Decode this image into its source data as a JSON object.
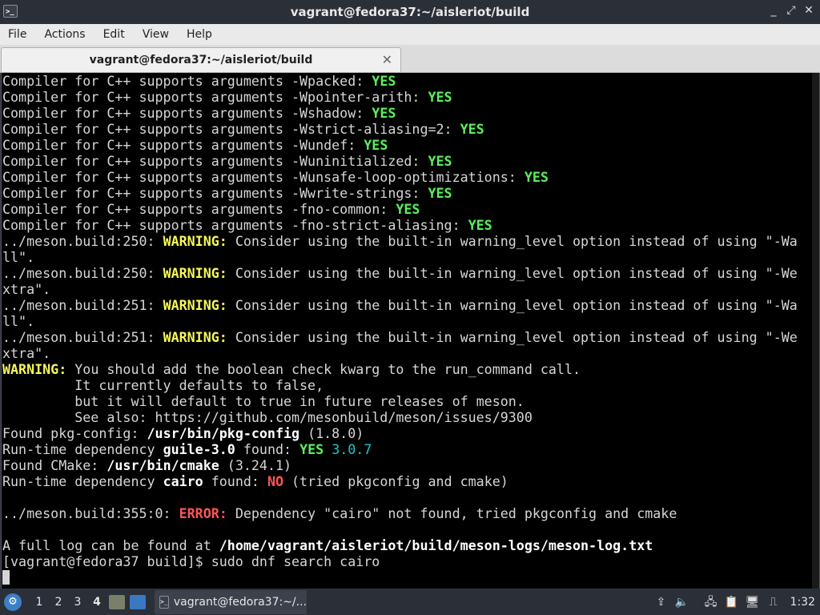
{
  "window": {
    "title": "vagrant@fedora37:~/aisleriot/build",
    "icon": "terminal-icon",
    "controls": [
      "_",
      "⤢",
      "✕"
    ]
  },
  "menu": [
    "File",
    "Actions",
    "Edit",
    "View",
    "Help"
  ],
  "tab": {
    "label": "vagrant@fedora37:~/aisleriot/build",
    "close": "✕"
  },
  "terminal": {
    "lines": [
      [
        {
          "t": "Compiler for C++ supports arguments -Wpacked: "
        },
        {
          "t": "YES",
          "c": "yes"
        }
      ],
      [
        {
          "t": "Compiler for C++ supports arguments -Wpointer-arith: "
        },
        {
          "t": "YES",
          "c": "yes"
        }
      ],
      [
        {
          "t": "Compiler for C++ supports arguments -Wshadow: "
        },
        {
          "t": "YES",
          "c": "yes"
        }
      ],
      [
        {
          "t": "Compiler for C++ supports arguments -Wstrict-aliasing=2: "
        },
        {
          "t": "YES",
          "c": "yes"
        }
      ],
      [
        {
          "t": "Compiler for C++ supports arguments -Wundef: "
        },
        {
          "t": "YES",
          "c": "yes"
        }
      ],
      [
        {
          "t": "Compiler for C++ supports arguments -Wuninitialized: "
        },
        {
          "t": "YES",
          "c": "yes"
        }
      ],
      [
        {
          "t": "Compiler for C++ supports arguments -Wunsafe-loop-optimizations: "
        },
        {
          "t": "YES",
          "c": "yes"
        }
      ],
      [
        {
          "t": "Compiler for C++ supports arguments -Wwrite-strings: "
        },
        {
          "t": "YES",
          "c": "yes"
        }
      ],
      [
        {
          "t": "Compiler for C++ supports arguments -fno-common: "
        },
        {
          "t": "YES",
          "c": "yes"
        }
      ],
      [
        {
          "t": "Compiler for C++ supports arguments -fno-strict-aliasing: "
        },
        {
          "t": "YES",
          "c": "yes"
        }
      ],
      [
        {
          "t": "../meson.build:250: "
        },
        {
          "t": "WARNING:",
          "c": "warn"
        },
        {
          "t": " Consider using the built-in warning_level option instead of using \"-Wa"
        }
      ],
      [
        {
          "t": "ll\"."
        }
      ],
      [
        {
          "t": "../meson.build:250: "
        },
        {
          "t": "WARNING:",
          "c": "warn"
        },
        {
          "t": " Consider using the built-in warning_level option instead of using \"-We"
        }
      ],
      [
        {
          "t": "xtra\"."
        }
      ],
      [
        {
          "t": "../meson.build:251: "
        },
        {
          "t": "WARNING:",
          "c": "warn"
        },
        {
          "t": " Consider using the built-in warning_level option instead of using \"-Wa"
        }
      ],
      [
        {
          "t": "ll\"."
        }
      ],
      [
        {
          "t": "../meson.build:251: "
        },
        {
          "t": "WARNING:",
          "c": "warn"
        },
        {
          "t": " Consider using the built-in warning_level option instead of using \"-We"
        }
      ],
      [
        {
          "t": "xtra\"."
        }
      ],
      [
        {
          "t": "WARNING:",
          "c": "warn"
        },
        {
          "t": " You should add the boolean check kwarg to the run_command call."
        }
      ],
      [
        {
          "t": "         It currently defaults to false,"
        }
      ],
      [
        {
          "t": "         but it will default to true in future releases of meson."
        }
      ],
      [
        {
          "t": "         See also: https://github.com/mesonbuild/meson/issues/9300"
        }
      ],
      [
        {
          "t": "Found pkg-config: "
        },
        {
          "t": "/usr/bin/pkg-config",
          "c": "bold"
        },
        {
          "t": " (1.8.0)"
        }
      ],
      [
        {
          "t": "Run-time dependency "
        },
        {
          "t": "guile-3.0",
          "c": "bold"
        },
        {
          "t": " found: "
        },
        {
          "t": "YES",
          "c": "yes"
        },
        {
          "t": " "
        },
        {
          "t": "3.0.7",
          "c": "ver"
        }
      ],
      [
        {
          "t": "Found CMake: "
        },
        {
          "t": "/usr/bin/cmake",
          "c": "bold"
        },
        {
          "t": " (3.24.1)"
        }
      ],
      [
        {
          "t": "Run-time dependency "
        },
        {
          "t": "cairo",
          "c": "bold"
        },
        {
          "t": " found: "
        },
        {
          "t": "NO",
          "c": "err"
        },
        {
          "t": " (tried pkgconfig and cmake)"
        }
      ],
      [],
      [
        {
          "t": "../meson.build:355:0: "
        },
        {
          "t": "ERROR:",
          "c": "err"
        },
        {
          "t": " Dependency \"cairo\" not found, tried pkgconfig and cmake"
        }
      ],
      [],
      [
        {
          "t": "A full log can be found at "
        },
        {
          "t": "/home/vagrant/aisleriot/build/meson-logs/meson-log.txt",
          "c": "bold"
        }
      ],
      [
        {
          "t": "[vagrant@fedora37 build]$ sudo dnf search cairo"
        }
      ]
    ]
  },
  "taskbar": {
    "workspaces": [
      "1",
      "2",
      "3",
      "4"
    ],
    "active_workspace": "4",
    "task_label": "vagrant@fedora37:~/...",
    "tray_icons": [
      "update-icon",
      "volume-icon",
      "network-icon",
      "clipboard-icon",
      "notification-icon"
    ],
    "clock": "1:32"
  },
  "colors": {
    "terminal_bg": "#000000",
    "yes": "#5af25a",
    "warning": "#f7f757",
    "error": "#ff5555"
  }
}
